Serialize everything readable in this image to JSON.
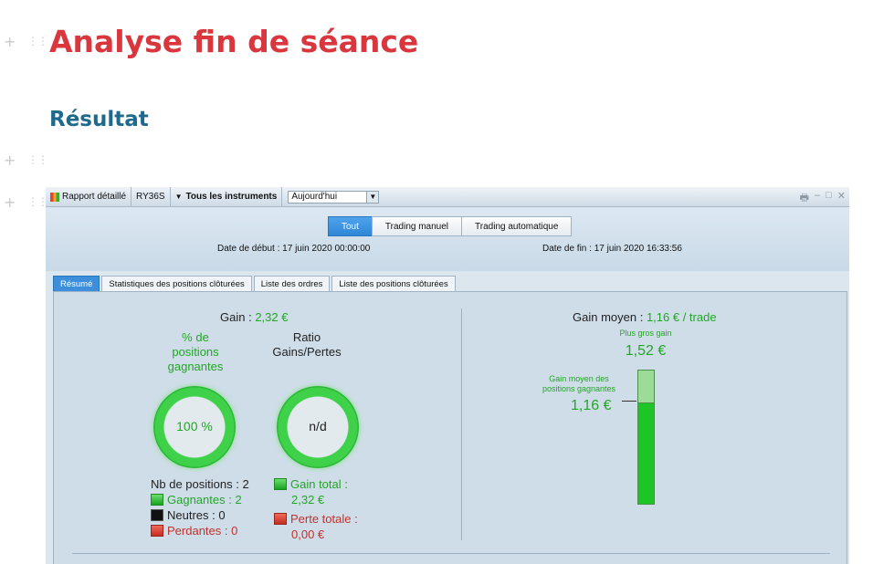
{
  "page": {
    "title": "Analyse fin de séance",
    "section": "Résultat"
  },
  "toolbar": {
    "report": "Rapport détaillé",
    "account": "RY36S",
    "instruments": "Tous les instruments",
    "period": "Aujourd'hui"
  },
  "mode_tabs": [
    "Tout",
    "Trading manuel",
    "Trading automatique"
  ],
  "dates": {
    "start_label": "Date de début :",
    "start_value": "17 juin 2020 00:00:00",
    "end_label": "Date de fin :",
    "end_value": "17 juin 2020 16:33:56"
  },
  "view_tabs": [
    "Résumé",
    "Statistiques des positions clôturées",
    "Liste des ordres",
    "Liste des positions clôturées"
  ],
  "summary": {
    "gain_label": "Gain :",
    "gain_value": "2,32 €",
    "winpct_title_l1": "% de",
    "winpct_title_l2": "positions",
    "winpct_title_l3": "gagnantes",
    "winpct_value": "100 %",
    "winpct_fraction": 1.0,
    "ratio_title_l1": "Ratio",
    "ratio_title_l2": "Gains/Pertes",
    "ratio_value": "n/d",
    "nb_positions": "Nb de positions : 2",
    "gagnantes": "Gagnantes : 2",
    "neutres": "Neutres : 0",
    "perdantes": "Perdantes : 0",
    "gain_total_label": "Gain total :",
    "gain_total_value": "2,32 €",
    "perte_totale_label": "Perte totale :",
    "perte_totale_value": "0,00 €"
  },
  "avg": {
    "gain_moyen_label": "Gain moyen :",
    "gain_moyen_value": "1,16 € / trade",
    "max_label": "Plus gros gain",
    "max_value": "1,52 €",
    "avg_win_label_l1": "Gain moyen des",
    "avg_win_label_l2": "positions gagnantes",
    "avg_win_value": "1,16 €",
    "bar_fill_fraction": 0.76
  },
  "colors": {
    "title": "#d9363e",
    "section": "#1e6a8d",
    "gain": "#22a626",
    "loss": "#c4312d",
    "active_tab": "#3d8fdc"
  }
}
